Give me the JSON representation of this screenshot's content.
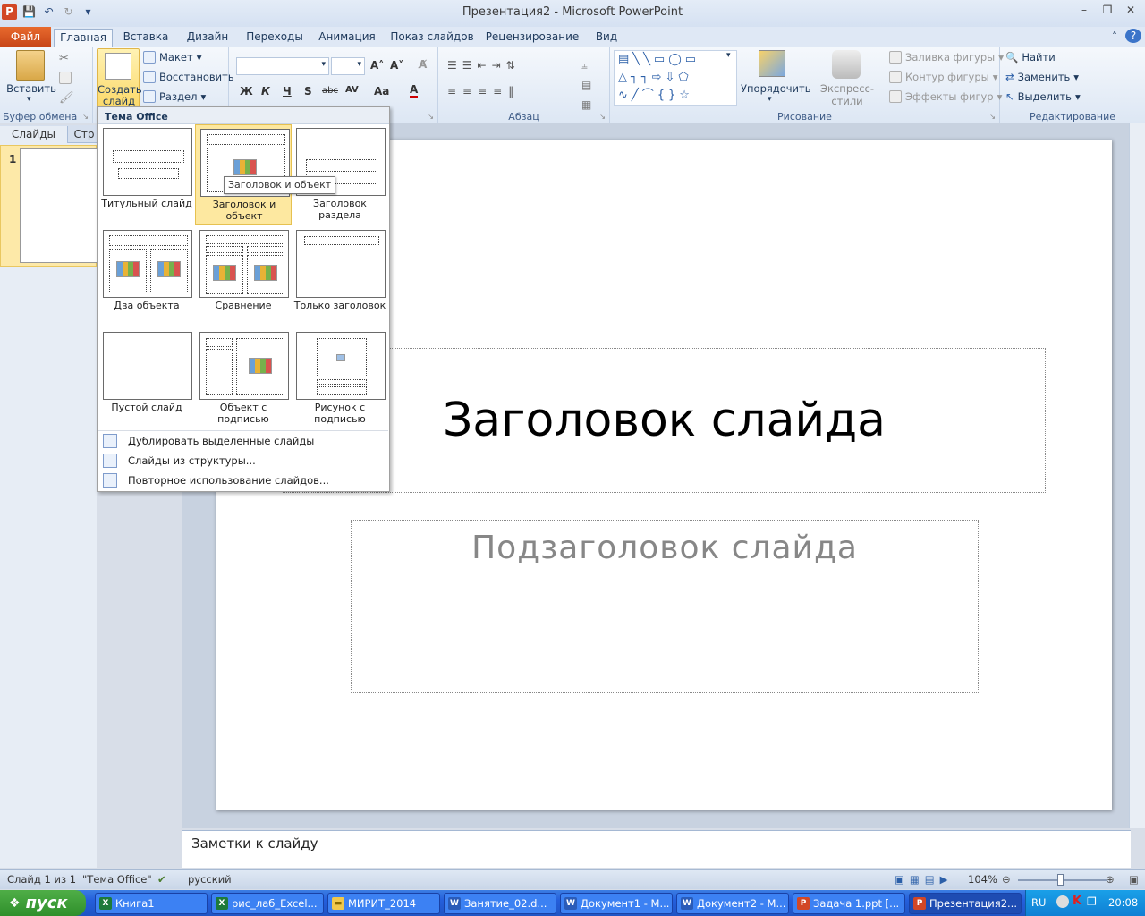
{
  "window": {
    "title": "Презентация2  -  Microsoft PowerPoint"
  },
  "tabs": {
    "file": "Файл",
    "items": [
      "Главная",
      "Вставка",
      "Дизайн",
      "Переходы",
      "Анимация",
      "Показ слайдов",
      "Рецензирование",
      "Вид"
    ]
  },
  "ribbon": {
    "clipboard": {
      "paste": "Вставить",
      "label": "Буфер обмена"
    },
    "slides": {
      "new_slide_line1": "Создать",
      "new_slide_line2": "слайд",
      "layout": "Макет",
      "reset": "Восстановить",
      "section": "Раздел"
    },
    "font": {
      "bold": "Ж",
      "italic": "К",
      "underline": "Ч",
      "shadow": "S",
      "strike": "abc",
      "spacing": "AV",
      "case": "Aa",
      "color": "A"
    },
    "paragraph": {
      "label": "Абзац"
    },
    "drawing": {
      "arrange": "Упорядочить",
      "quick_styles": "Экспресс-стили",
      "fill": "Заливка фигуры",
      "outline": "Контур фигуры",
      "effects": "Эффекты фигур",
      "label": "Рисование"
    },
    "editing": {
      "find": "Найти",
      "replace": "Заменить",
      "select": "Выделить",
      "label": "Редактирование"
    }
  },
  "panel": {
    "tab_slides": "Слайды",
    "tab_outline": "Стр",
    "slide_number": "1"
  },
  "dropdown": {
    "header": "Тема Office",
    "layouts": [
      {
        "name": "Титульный слайд"
      },
      {
        "name": "Заголовок и объект"
      },
      {
        "name": "Заголовок раздела"
      },
      {
        "name": "Два объекта"
      },
      {
        "name": "Сравнение"
      },
      {
        "name": "Только заголовок"
      },
      {
        "name": "Пустой слайд"
      },
      {
        "name": "Объект с подписью"
      },
      {
        "name": "Рисунок с подписью"
      }
    ],
    "menu": [
      "Дублировать выделенные слайды",
      "Слайды из структуры...",
      "Повторное использование слайдов..."
    ],
    "tooltip": "Заголовок и объект"
  },
  "slide": {
    "title": "Заголовок слайда",
    "subtitle": "Подзаголовок  слайда"
  },
  "notes": {
    "placeholder": "Заметки к слайду"
  },
  "status": {
    "slide_info": "Слайд 1 из 1",
    "theme": "\"Тема Office\"",
    "language": "русский",
    "zoom": "104%"
  },
  "taskbar": {
    "start": "пуск",
    "items": [
      "Книга1",
      "рис_лаб_Excel...",
      "МИРИТ_2014",
      "Занятие_02.d...",
      "Документ1 - М...",
      "Документ2 - М...",
      "Задача 1.ppt [...",
      "Презентация2..."
    ],
    "lang": "RU",
    "clock": "20:08"
  }
}
